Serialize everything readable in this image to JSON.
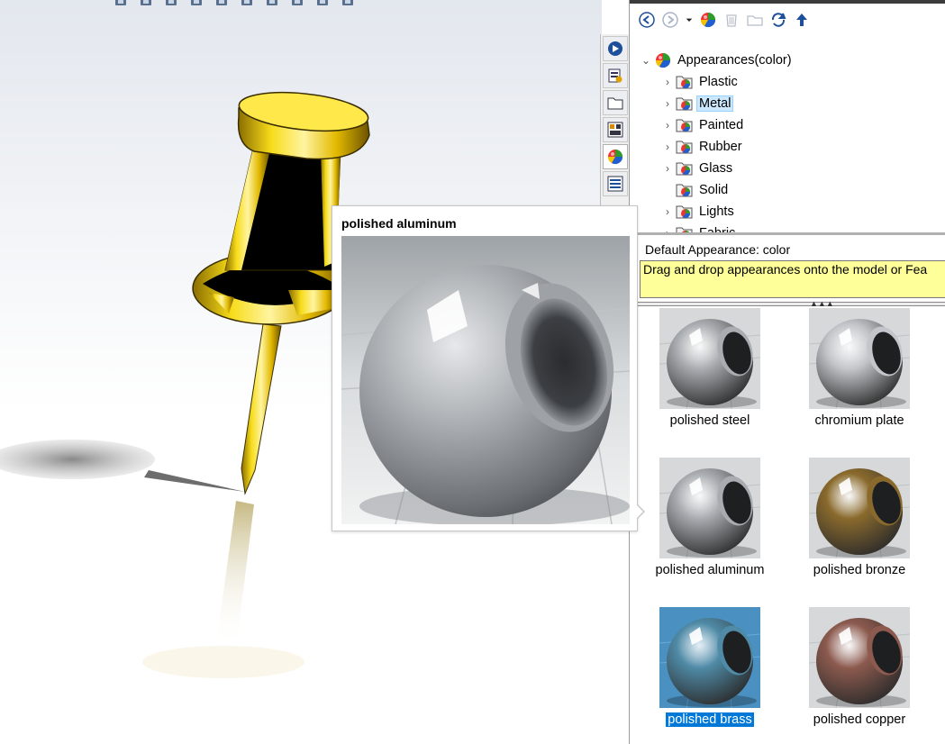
{
  "viewport": {
    "toolbar_icons": [
      "zoom-to-fit-icon",
      "zoom-area-icon",
      "previous-view-icon",
      "section-view-icon",
      "view-orientation-icon",
      "display-style-icon",
      "hide-show-icon",
      "edit-appearance-icon",
      "scene-icon",
      "view-settings-icon"
    ]
  },
  "side_tabs": [
    "solidworks-resources-icon",
    "design-library-icon",
    "file-explorer-icon",
    "view-palette-icon",
    "appearances-scenes-decals-icon",
    "custom-properties-icon"
  ],
  "taskpane": {
    "toolbar": [
      "back-icon",
      "forward-icon",
      "dropdown-arrow-icon",
      "appearance-add-icon",
      "recycle-icon",
      "folder-icon",
      "refresh-icon",
      "up-level-icon"
    ],
    "tree": {
      "root": "Appearances(color)",
      "items": [
        {
          "label": "Plastic",
          "expandable": true,
          "selected": false
        },
        {
          "label": "Metal",
          "expandable": true,
          "selected": true
        },
        {
          "label": "Painted",
          "expandable": true,
          "selected": false
        },
        {
          "label": "Rubber",
          "expandable": true,
          "selected": false
        },
        {
          "label": "Glass",
          "expandable": true,
          "selected": false
        },
        {
          "label": "Solid",
          "expandable": false,
          "selected": false
        },
        {
          "label": "Lights",
          "expandable": true,
          "selected": false
        },
        {
          "label": "Fabric",
          "expandable": true,
          "selected": false
        }
      ]
    },
    "default_appearance": "Default Appearance: color",
    "help_text": "Drag and drop appearances onto the model or Fea",
    "swatches": [
      {
        "label": "polished steel",
        "tint": "#a9acb0",
        "selected": false
      },
      {
        "label": "chromium plate",
        "tint": "#c2c5c9",
        "selected": false
      },
      {
        "label": "polished aluminum",
        "tint": "#a8abb0",
        "selected": false
      },
      {
        "label": "polished bronze",
        "tint": "#8a6a2c",
        "selected": false
      },
      {
        "label": "polished brass",
        "tint": "#4f8aa6",
        "selected": true
      },
      {
        "label": "polished copper",
        "tint": "#8c5a4e",
        "selected": false
      }
    ]
  },
  "preview": {
    "title": "polished aluminum"
  },
  "colors": {
    "selection_blue": "#0078d7",
    "tree_selected": "#cce8ff",
    "help_yellow": "#ffff99",
    "pin_yellow": "#f5d000"
  }
}
